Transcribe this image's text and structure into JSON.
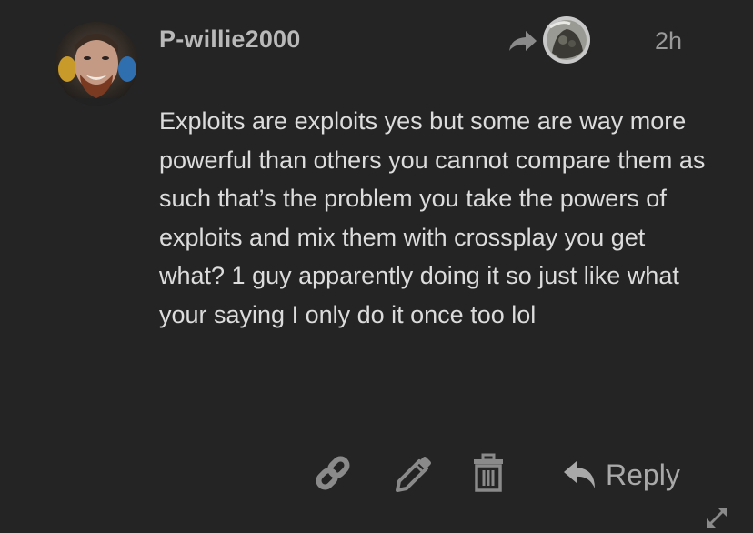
{
  "post": {
    "username": "P-willie2000",
    "timestamp": "2h",
    "body": "Exploits are exploits yes but some are way more powerful than others you cannot compare them as such that’s the problem you take the powers of exploits and mix them with crossplay you get what? 1 guy apparently doing it so just like what your saying I only do it once too lol"
  },
  "actions": {
    "reply_label": "Reply",
    "icons": [
      "link-icon",
      "pencil-icon",
      "trash-icon",
      "reply-arrow-icon",
      "expand-icon"
    ]
  },
  "colors": {
    "background": "#242424",
    "username": "#b9b9b9",
    "body_text": "#dcdcdc",
    "icon": "#8a8a8a"
  }
}
